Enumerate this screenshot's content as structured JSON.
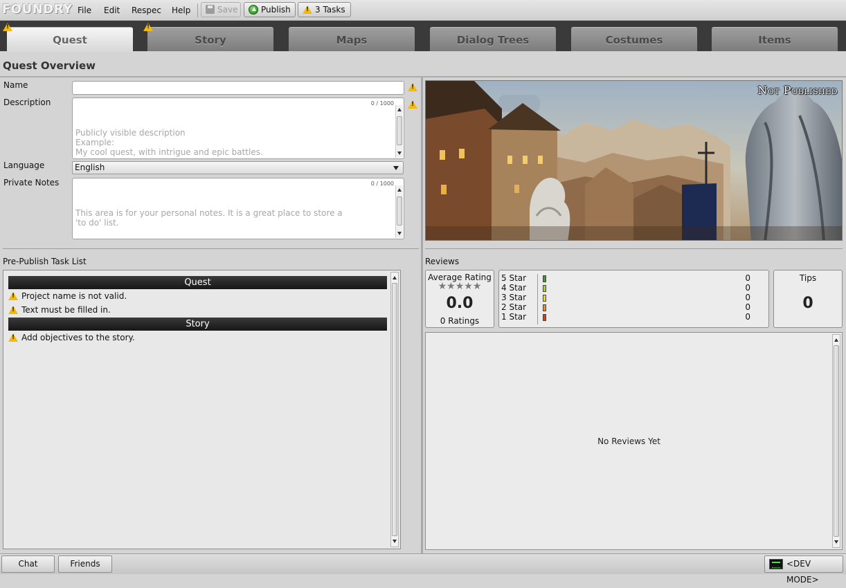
{
  "app": {
    "logo": "FOUNDRY"
  },
  "menu": {
    "items": [
      "File",
      "Edit",
      "Respec",
      "Help"
    ]
  },
  "toolbar": {
    "save_label": "Save",
    "publish_label": "Publish",
    "tasks_label": "3 Tasks"
  },
  "tabs": [
    {
      "label": "Quest",
      "active": true,
      "warning": true
    },
    {
      "label": "Story",
      "active": false,
      "warning": true
    },
    {
      "label": "Maps",
      "active": false,
      "warning": false
    },
    {
      "label": "Dialog Trees",
      "active": false,
      "warning": false
    },
    {
      "label": "Costumes",
      "active": false,
      "warning": false
    },
    {
      "label": "Items",
      "active": false,
      "warning": false
    }
  ],
  "page": {
    "title": "Quest Overview"
  },
  "form": {
    "name_label": "Name",
    "name_value": "",
    "description_label": "Description",
    "description_counter": "0 / 1000",
    "description_placeholder": "Publicly visible description\nExample:\nMy cool quest, with intrigue and epic battles.",
    "language_label": "Language",
    "language_value": "English",
    "notes_label": "Private Notes",
    "notes_counter": "0 / 1000",
    "notes_placeholder": "This area is for your personal notes. It is a great place to store a\n'to do' list."
  },
  "tasks": {
    "title": "Pre-Publish Task List",
    "groups": [
      {
        "header": "Quest",
        "items": [
          "Project name is not valid.",
          "Text must be filled in."
        ]
      },
      {
        "header": "Story",
        "items": [
          "Add objectives to the story."
        ]
      }
    ]
  },
  "preview": {
    "status": "Not Published"
  },
  "reviews": {
    "title": "Reviews",
    "average_label": "Average Rating",
    "average_value": "0.0",
    "ratings_count": "0 Ratings",
    "stars_filled": 0,
    "stars_total": 5,
    "breakdown": [
      {
        "label": "5 Star",
        "count": "0",
        "color": "#3f9a1f"
      },
      {
        "label": "4 Star",
        "count": "0",
        "color": "#a5d21c"
      },
      {
        "label": "3 Star",
        "count": "0",
        "color": "#f2d21a"
      },
      {
        "label": "2 Star",
        "count": "0",
        "color": "#f08a1a"
      },
      {
        "label": "1 Star",
        "count": "0",
        "color": "#e03a14"
      }
    ],
    "tips_label": "Tips",
    "tips_value": "0",
    "empty_text": "No Reviews Yet"
  },
  "statusbar": {
    "chat_label": "Chat",
    "friends_label": "Friends",
    "devmode_label": "<DEV MODE>"
  },
  "colors": {
    "warning": "#f2b90f",
    "tab_strip": "#3a3a3a",
    "task_header": "#1e1e1e"
  }
}
